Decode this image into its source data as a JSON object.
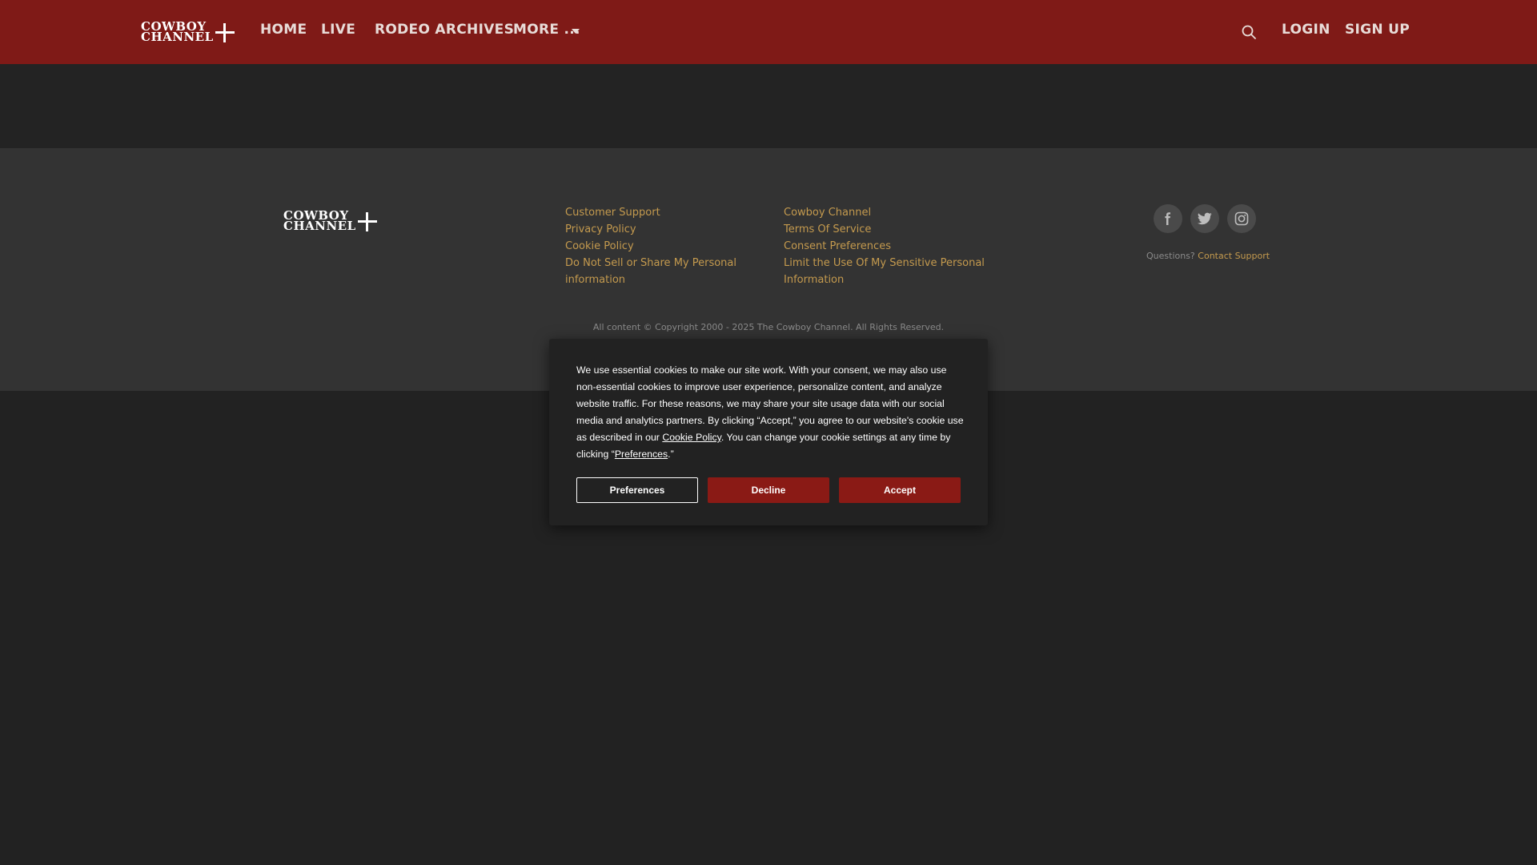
{
  "brand": {
    "logo_line1": "COWBOY",
    "logo_line2": "CHANNEL",
    "header_bg": "#7f1a17",
    "link_color": "#c49a4e"
  },
  "nav": {
    "items": [
      {
        "label": "HOME"
      },
      {
        "label": "LIVE"
      },
      {
        "label": "RODEO ARCHIVES"
      },
      {
        "label": "MORE ..."
      }
    ],
    "search_icon": "search-icon",
    "login_label": "LOGIN",
    "signup_label": "SIGN UP"
  },
  "footer": {
    "col1": [
      {
        "label": "Customer Support"
      },
      {
        "label": "Privacy Policy"
      },
      {
        "label": "Cookie Policy"
      },
      {
        "label": "Do Not Sell or Share My Personal information"
      }
    ],
    "col2": [
      {
        "label": "Cowboy Channel"
      },
      {
        "label": "Terms Of Service"
      },
      {
        "label": "Consent Preferences"
      },
      {
        "label": "Limit the Use Of My Sensitive Personal Information"
      }
    ],
    "social": [
      {
        "icon": "facebook-icon"
      },
      {
        "icon": "twitter-icon"
      },
      {
        "icon": "instagram-icon"
      }
    ],
    "questions_label": "Questions?",
    "contact_label": "Contact Support",
    "copyright": "All content © Copyright 2000 - 2025 The Cowboy Channel. All Rights Reserved."
  },
  "cookie": {
    "text_part1": "We use essential cookies to make our site work. With your consent, we may also use non-essential cookies to improve user experience, personalize content, and analyze website traffic. For these reasons, we may share your site usage data with our social media and analytics partners. By clicking “Accept,” you agree to our website's cookie use as described in our ",
    "cookie_policy_link": "Cookie Policy",
    "text_part2": ". You can change your cookie settings at any time by clicking “",
    "preferences_link": "Preferences",
    "text_part3": ".”",
    "preferences_button": "Preferences",
    "decline_button": "Decline",
    "accept_button": "Accept"
  }
}
